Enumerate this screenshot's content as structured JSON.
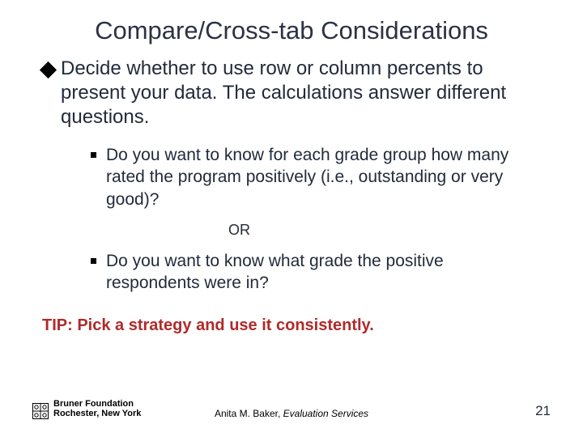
{
  "title": "Compare/Cross-tab Considerations",
  "main": {
    "lead": "Decide",
    "rest": " whether to use row or column percents to present your data.  The calculations answer different questions."
  },
  "subs": {
    "a": "Do you want to know for each grade group how many rated the program positively (i.e., outstanding or very good)?",
    "b": "Do you want to know what grade the positive respondents were in?"
  },
  "or": "OR",
  "tip": "TIP:  Pick a strategy and use it consistently.",
  "footer": {
    "org1": "Bruner Foundation",
    "org2": "Rochester, New York",
    "author": "Anita M. Baker, ",
    "svc": "Evaluation Services",
    "page": "21"
  }
}
